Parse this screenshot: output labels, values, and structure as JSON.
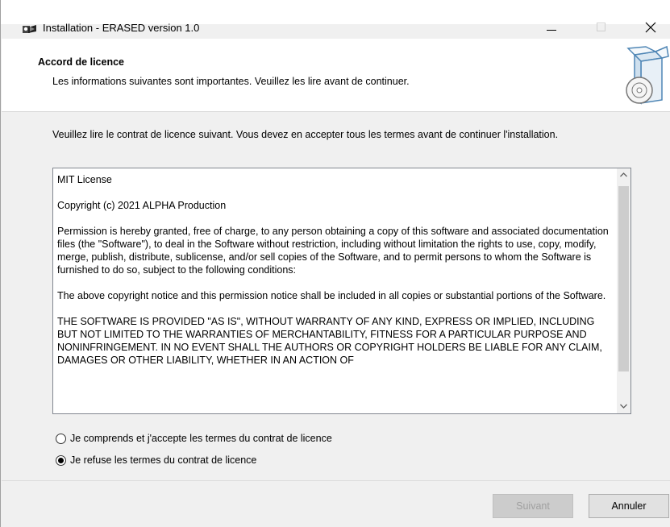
{
  "window": {
    "title": "Installation - ERASED version 1.0"
  },
  "header": {
    "title": "Accord de licence",
    "subtitle": "Les informations suivantes sont importantes. Veuillez les lire avant de continuer."
  },
  "intro": "Veuillez lire le contrat de licence suivant. Vous devez en accepter tous les termes avant de continuer l'installation.",
  "license": {
    "paragraphs": [
      "MIT License",
      "Copyright (c) 2021 ALPHA Production",
      "Permission is hereby granted, free of charge, to any person obtaining a copy of this software and associated documentation files (the \"Software\"), to deal in the Software without restriction, including without limitation the rights to use, copy, modify, merge, publish, distribute, sublicense, and/or sell copies of the Software, and to permit persons to whom the Software is furnished to do so, subject to the following conditions:",
      "The above copyright notice and this permission notice shall be included in all copies or substantial portions of the Software.",
      "THE SOFTWARE IS PROVIDED \"AS IS\", WITHOUT WARRANTY OF ANY KIND, EXPRESS OR IMPLIED, INCLUDING BUT NOT LIMITED TO THE WARRANTIES OF MERCHANTABILITY, FITNESS FOR A PARTICULAR PURPOSE AND NONINFRINGEMENT. IN NO EVENT SHALL THE AUTHORS OR COPYRIGHT HOLDERS BE LIABLE FOR ANY CLAIM, DAMAGES OR OTHER LIABILITY, WHETHER IN AN ACTION OF"
    ]
  },
  "options": {
    "accept_label": "Je comprends et j'accepte les termes du contrat de licence",
    "refuse_label": "Je refuse les termes du contrat de licence",
    "selected": "refuse"
  },
  "buttons": {
    "next_label": "Suivant",
    "cancel_label": "Annuler"
  },
  "icons": {
    "app": "installer-icon",
    "header": "software-box-icon"
  }
}
